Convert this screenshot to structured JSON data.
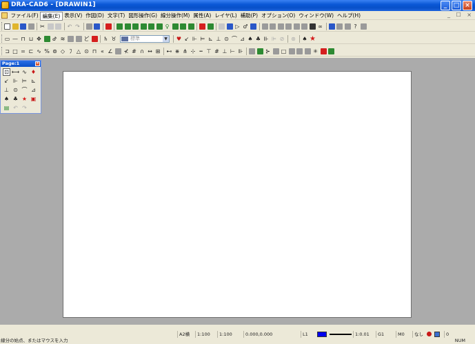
{
  "window": {
    "title": "DRA-CAD6 - [DRAWIN1]",
    "min_glyph": "_",
    "max_glyph": "□",
    "close_glyph": "×"
  },
  "menu": {
    "items": [
      {
        "label": "ファイル(F)"
      },
      {
        "label": "編集(E)"
      },
      {
        "label": "表示(V)"
      },
      {
        "label": "作図(D)"
      },
      {
        "label": "文字(T)"
      },
      {
        "label": "図形操作(G)"
      },
      {
        "label": "線分操作(M)"
      },
      {
        "label": "属性(A)"
      },
      {
        "label": "レイヤ(L)"
      },
      {
        "label": "補助(P)"
      },
      {
        "label": "オプション(O)"
      },
      {
        "label": "ウィンドウ(W)"
      },
      {
        "label": "ヘルプ(H)"
      }
    ],
    "mdi_controls": "_ ☐ ×"
  },
  "toolbar": {
    "style_combo_text": "標準",
    "dropdown_glyph": "▼"
  },
  "palette": {
    "title": "Page:1",
    "close_glyph": "×",
    "tools": [
      "⊡",
      "⟷",
      "∿",
      "♦",
      "↙",
      "⊩",
      "⊨",
      "⊾",
      "⊥",
      "⊙",
      "⌒",
      "⊿",
      "♠",
      "♣",
      "★",
      "▣",
      "▤",
      "↶",
      "↷"
    ]
  },
  "status": {
    "paper_size": "A2横",
    "scale1": "1:100",
    "scale2": "1:100",
    "coords": "0.000,0.000",
    "layer": "L1",
    "line_scale": "1:0.01",
    "group": "G1",
    "mode": "M0",
    "snap": "なし",
    "count": "0",
    "prompt": "線分の始点、またはマウスを入力",
    "num": "NUM"
  },
  "colors": {
    "current_color": "#0000ee",
    "background": "#ababab"
  }
}
